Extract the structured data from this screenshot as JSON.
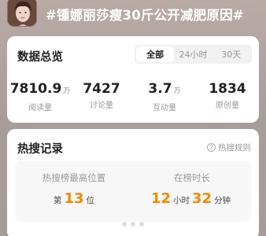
{
  "header": {
    "title": "#锺娜丽莎瘦30斤公开减肥原因#"
  },
  "overview": {
    "title": "数据总览",
    "tabs": [
      {
        "label": "全部",
        "active": true
      },
      {
        "label": "24小时",
        "active": false
      },
      {
        "label": "30天",
        "active": false
      }
    ],
    "stats": [
      {
        "value": "7810.9",
        "unit": "万",
        "label": "阅读量"
      },
      {
        "value": "7427",
        "unit": "",
        "label": "讨论量"
      },
      {
        "value": "3.7",
        "unit": "万",
        "label": "互动量"
      },
      {
        "value": "1834",
        "unit": "",
        "label": "原创量"
      }
    ]
  },
  "hot_record": {
    "title": "热搜记录",
    "rules_label": "热搜规则",
    "rules_icon": "question-icon",
    "highest_rank": {
      "label": "热搜榜最高位置",
      "prefix": "第",
      "value": "13",
      "suffix": "位"
    },
    "duration": {
      "label": "在榜时长",
      "hours": "12",
      "hours_unit": "小时",
      "minutes": "32",
      "minutes_unit": "分钟"
    }
  },
  "colors": {
    "accent": "#f08a00"
  }
}
